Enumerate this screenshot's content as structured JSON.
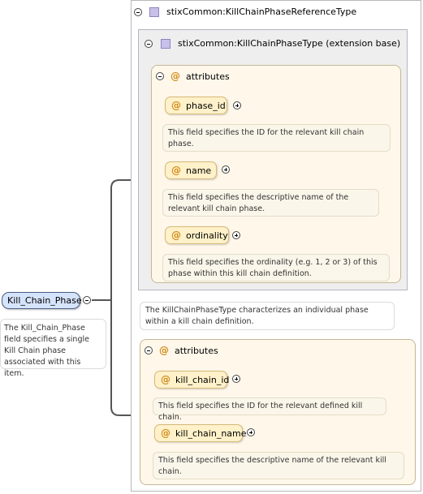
{
  "element": {
    "name": "Kill_Chain_Phase",
    "doc": "The Kill_Chain_Phase field specifies a single Kill Chain phase associated with this item."
  },
  "type": {
    "name": "stixCommon:KillChainPhaseReferenceType",
    "icon": "complex-type-icon"
  },
  "extension": {
    "name": "stixCommon:KillChainPhaseType (extension base)",
    "doc": "The KillChainPhaseType characterizes an individual phase within a kill chain definition.",
    "attributes_label": "attributes",
    "attributes": [
      {
        "name": "phase_id",
        "doc": "This field specifies the ID for the relevant kill chain phase."
      },
      {
        "name": "name",
        "doc": "This field specifies the descriptive name of the relevant kill chain phase."
      },
      {
        "name": "ordinality",
        "doc": "This field specifies the ordinality (e.g. 1, 2 or 3) of this phase within this kill chain definition."
      }
    ]
  },
  "own_attributes": {
    "label": "attributes",
    "items": [
      {
        "name": "kill_chain_id",
        "doc": "This field specifies the ID for the relevant defined kill chain."
      },
      {
        "name": "kill_chain_name",
        "doc": "This field specifies the descriptive name of the relevant kill chain."
      }
    ]
  },
  "symbols": {
    "at": "@"
  },
  "colors": {
    "element_fill": "#d6e4fb",
    "attribute_fill": "#fff1c9",
    "connector": "#555555"
  }
}
